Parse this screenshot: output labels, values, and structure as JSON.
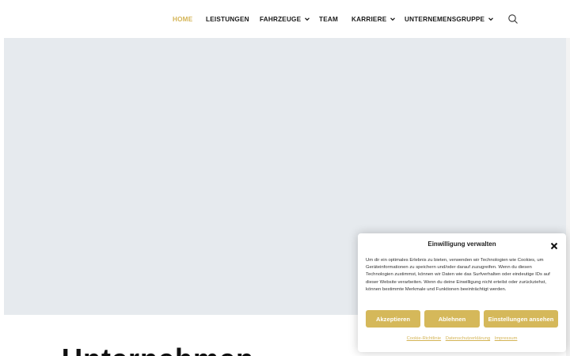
{
  "nav": {
    "items": [
      {
        "label": "HOME",
        "active": true,
        "has_dropdown": false
      },
      {
        "label": "LEISTUNGEN",
        "active": false,
        "has_dropdown": false
      },
      {
        "label": "FAHRZEUGE",
        "active": false,
        "has_dropdown": true
      },
      {
        "label": "TEAM",
        "active": false,
        "has_dropdown": false
      },
      {
        "label": "KARRIERE",
        "active": false,
        "has_dropdown": true
      },
      {
        "label": "UNTERNEMENSGRUPPE",
        "active": false,
        "has_dropdown": true
      }
    ],
    "search_icon": "search-icon",
    "active_color": "#d4b455"
  },
  "hero": {
    "background": "#e6eaee"
  },
  "main": {
    "heading_partial": "Unternehmen"
  },
  "cookie_dialog": {
    "title": "Einwilligung verwalten",
    "text": "Um dir ein optimales Erlebnis zu bieten, verwenden wir Technologien wie Cookies, um Geräteinformationen zu speichern und/oder darauf zuzugreifen. Wenn du diesen Technologien zustimmst, können wir Daten wie das Surfverhalten oder eindeutige IDs auf dieser Website verarbeiten. Wenn du deine Einwilligung nicht erteilst oder zurückziehst, können bestimmte Merkmale und Funktionen beeinträchtigt werden.",
    "buttons": {
      "accept": "Akzeptieren",
      "decline": "Ablehnen",
      "settings": "Einstellungen ansehen"
    },
    "links": [
      "Cookie-Richtlinie",
      "Datenschutzerklärung",
      "Impressum"
    ],
    "button_color": "#d5b85a"
  }
}
